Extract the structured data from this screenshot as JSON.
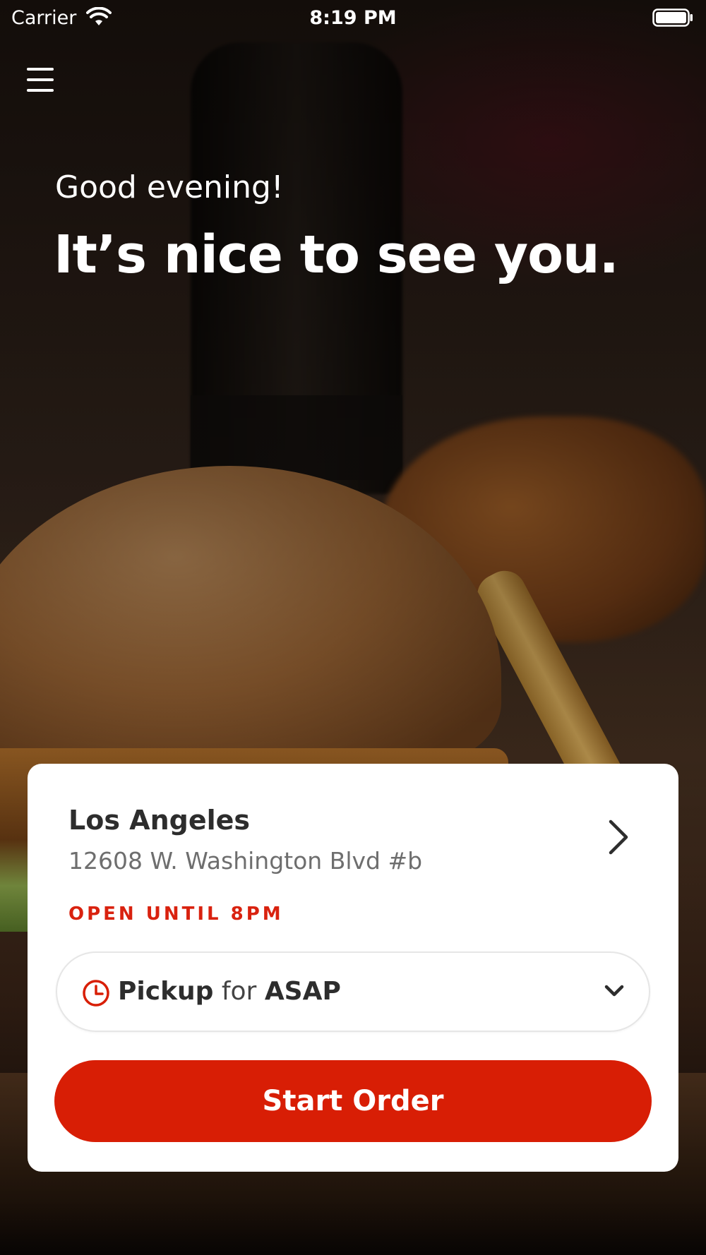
{
  "status_bar": {
    "carrier": "Carrier",
    "time": "8:19 PM"
  },
  "icons": {
    "menu": "hamburger-menu-icon",
    "wifi": "wifi-icon",
    "battery": "battery-icon",
    "location_chevron": "chevron-right-icon",
    "clock": "clock-icon",
    "dropdown": "chevron-down-icon"
  },
  "greeting": {
    "subtitle": "Good evening!",
    "title": "It’s nice to see you."
  },
  "location": {
    "name": "Los Angeles",
    "address": "12608 W. Washington Blvd #b",
    "hours": "OPEN UNTIL 8PM"
  },
  "order_mode": {
    "mode": "Pickup",
    "connector": "for",
    "time": "ASAP"
  },
  "start_order_label": "Start Order",
  "colors": {
    "accent": "#d81e05",
    "card_background": "#ffffff",
    "text_primary": "#2d2d2d",
    "text_secondary": "#6e6e6e"
  }
}
